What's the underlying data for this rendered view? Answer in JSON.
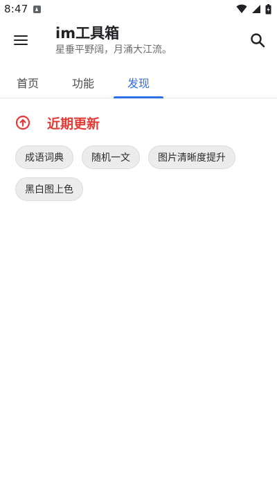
{
  "status_bar": {
    "time": "8:47"
  },
  "app_bar": {
    "title": "im工具箱",
    "subtitle": "星垂平野阔，月涌大江流。"
  },
  "tabs": [
    {
      "label": "首页"
    },
    {
      "label": "功能"
    },
    {
      "label": "发现"
    }
  ],
  "section": {
    "title": "近期更新",
    "accent_color": "#e53935",
    "items": [
      {
        "label": "成语词典"
      },
      {
        "label": "随机一文"
      },
      {
        "label": "图片清晰度提升"
      },
      {
        "label": "黑白图上色"
      }
    ]
  },
  "colors": {
    "active_tab": "#2f6fe4"
  }
}
